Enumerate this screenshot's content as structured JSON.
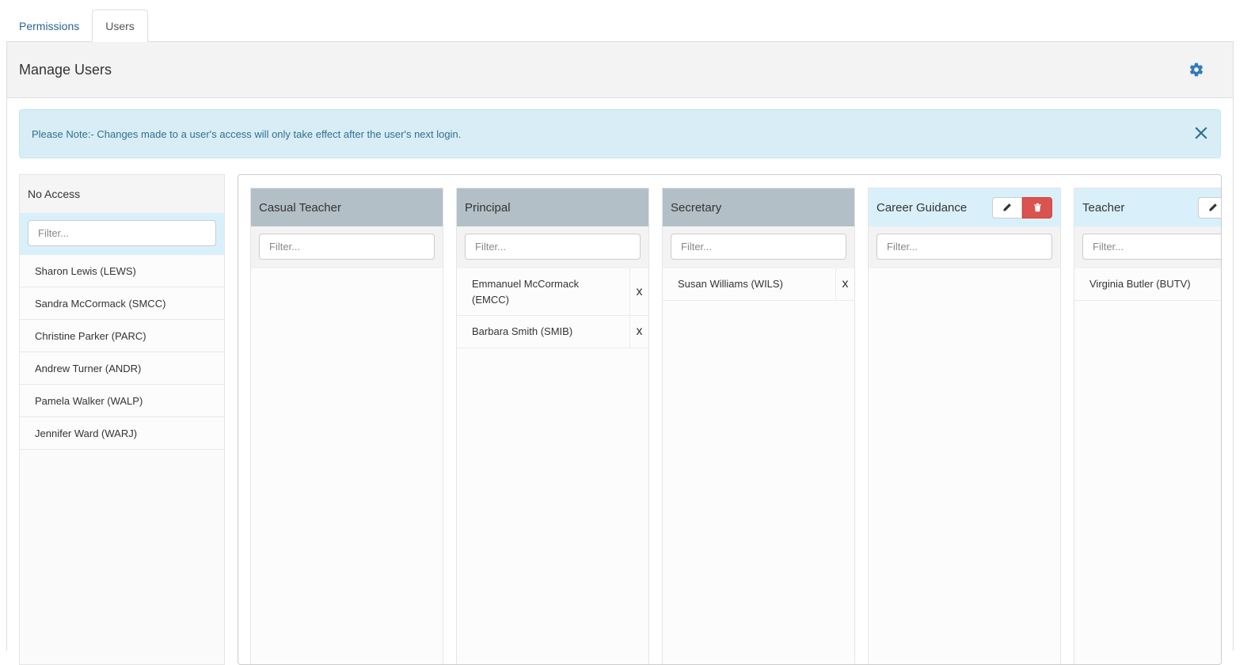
{
  "tabs": [
    {
      "label": "Permissions",
      "active": false
    },
    {
      "label": "Users",
      "active": true
    }
  ],
  "header": {
    "title": "Manage Users"
  },
  "alert": {
    "message": "Please Note:- Changes made to a user's access will only take effect after the user's next login."
  },
  "no_access": {
    "title": "No Access",
    "filter_placeholder": "Filter...",
    "users": [
      "Sharon Lewis (LEWS)",
      "Sandra McCormack (SMCC)",
      "Christine Parker (PARC)",
      "Andrew Turner (ANDR)",
      "Pamela Walker (WALP)",
      "Jennifer Ward (WARJ)"
    ]
  },
  "roles": [
    {
      "name": "Casual Teacher",
      "filter_placeholder": "Filter...",
      "users": []
    },
    {
      "name": "Principal",
      "filter_placeholder": "Filter...",
      "users": [
        "Emmanuel McCormack (EMCC)",
        "Barbara Smith (SMIB)"
      ]
    },
    {
      "name": "Secretary",
      "filter_placeholder": "Filter...",
      "users": [
        "Susan Williams (WILS)"
      ]
    },
    {
      "name": "Career Guidance",
      "filter_placeholder": "Filter...",
      "users": []
    },
    {
      "name": "Teacher",
      "filter_placeholder": "Filter...",
      "users": [
        "Virginia Butler (BUTV)"
      ]
    }
  ],
  "remove_label": "x",
  "colors": {
    "accent": "#337ab7",
    "system_role_header": "#b3bfc7",
    "custom_role_header": "#d9f0fa",
    "delete_button": "#d9534f",
    "alert_bg": "#d9edf7"
  },
  "icons": {
    "settings": "gear-icon",
    "close": "close-icon",
    "edit": "pencil-icon",
    "delete": "trash-icon"
  }
}
